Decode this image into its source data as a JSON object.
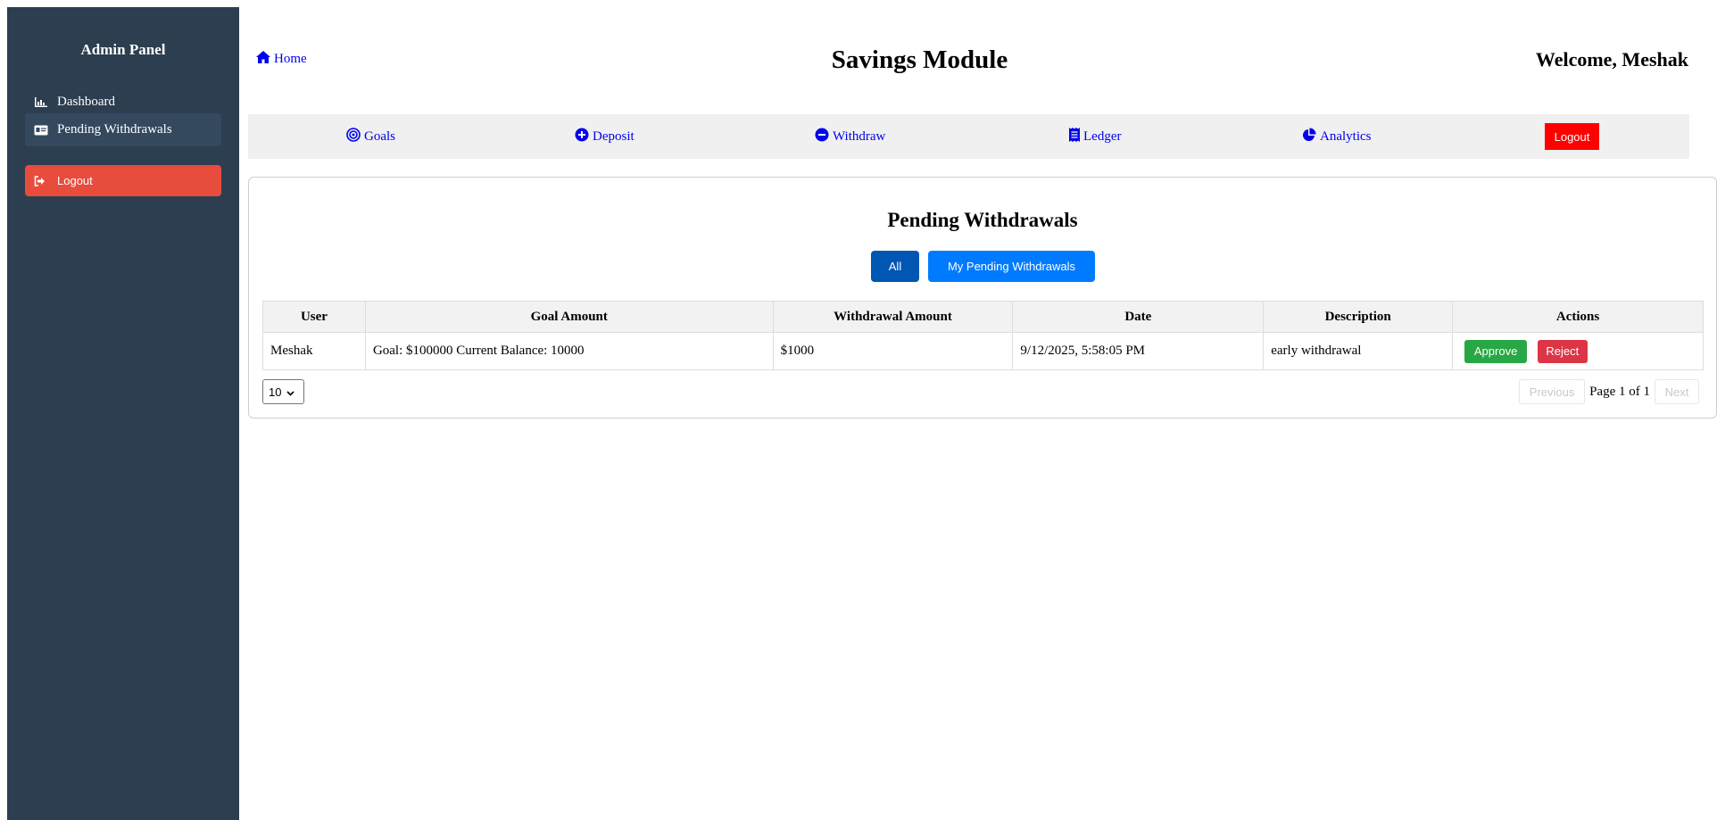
{
  "sidebar": {
    "title": "Admin Panel",
    "items": [
      {
        "label": "Dashboard",
        "icon": "bar-chart-icon"
      },
      {
        "label": "Pending Withdrawals",
        "icon": "id-card-icon",
        "active": true
      }
    ],
    "logout_label": "Logout"
  },
  "header": {
    "home_label": "Home",
    "title": "Savings Module",
    "welcome": "Welcome, Meshak"
  },
  "nav": {
    "items": [
      {
        "label": "Goals",
        "icon": "target-icon"
      },
      {
        "label": "Deposit",
        "icon": "plus-circle-icon"
      },
      {
        "label": "Withdraw",
        "icon": "minus-circle-icon"
      },
      {
        "label": "Ledger",
        "icon": "receipt-icon"
      },
      {
        "label": "Analytics",
        "icon": "pie-chart-icon"
      }
    ],
    "logout_label": "Logout"
  },
  "main": {
    "title": "Pending Withdrawals",
    "filters": {
      "all": "All",
      "mine": "My Pending Withdrawals",
      "selected": "All"
    },
    "table": {
      "headers": [
        "User",
        "Goal Amount",
        "Withdrawal Amount",
        "Date",
        "Description",
        "Actions"
      ],
      "rows": [
        {
          "user": "Meshak",
          "goal": "Goal: $100000 Current Balance: 10000",
          "amount": "$1000",
          "date": "9/12/2025, 5:58:05 PM",
          "description": "early withdrawal",
          "approve": "Approve",
          "reject": "Reject"
        }
      ]
    },
    "pagination": {
      "page_size": "10",
      "previous": "Previous",
      "page_text": "Page 1 of 1",
      "next": "Next"
    }
  },
  "colors": {
    "sidebar_bg": "#2c3e50",
    "sidebar_active": "#34495e",
    "sidebar_logout": "#e74c3c",
    "nav_logout": "#ff0000",
    "link": "#0000ee",
    "primary": "#007bff",
    "primary_active": "#0056b3",
    "approve": "#28a745",
    "reject": "#dc3545"
  }
}
